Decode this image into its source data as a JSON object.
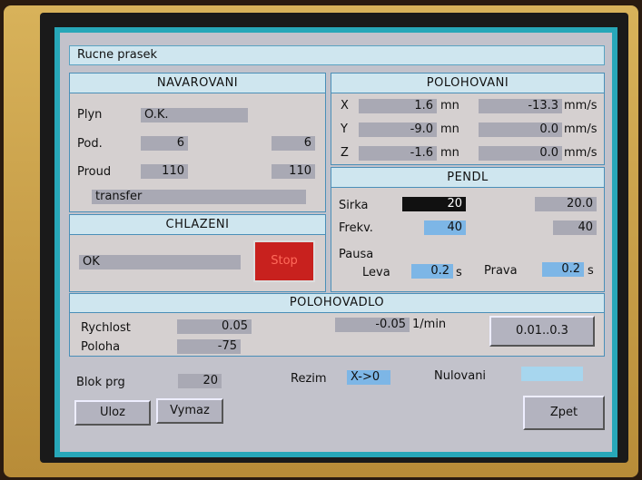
{
  "window_title": "Rucne prasek",
  "navarovani": {
    "title": "NAVAROVANI",
    "plyn_label": "Plyn",
    "plyn_value": "O.K.",
    "pod_label": "Pod.",
    "pod_set": "6",
    "pod_actual": "6",
    "proud_label": "Proud",
    "proud_set": "110",
    "proud_actual": "110",
    "mode_value": "transfer"
  },
  "polohovani": {
    "title": "POLOHOVANI",
    "rows": [
      {
        "axis": "X",
        "position": "1.6",
        "position_unit": "mn",
        "speed": "-13.3",
        "speed_unit": "mm/s"
      },
      {
        "axis": "Y",
        "position": "-9.0",
        "position_unit": "mn",
        "speed": "0.0",
        "speed_unit": "mm/s"
      },
      {
        "axis": "Z",
        "position": "-1.6",
        "position_unit": "mn",
        "speed": "0.0",
        "speed_unit": "mm/s"
      }
    ]
  },
  "pendl": {
    "title": "PENDL",
    "sirka_label": "Sirka",
    "sirka_set": "20",
    "sirka_actual": "20.0",
    "frekv_label": "Frekv.",
    "frekv_set": "40",
    "frekv_actual": "40",
    "pausa_label": "Pausa",
    "leva_label": "Leva",
    "leva_value": "0.2",
    "leva_unit": "s",
    "prava_label": "Prava",
    "prava_value": "0.2",
    "prava_unit": "s"
  },
  "chlazeni": {
    "title": "CHLAZENI",
    "status_value": "OK",
    "stop_label": "Stop"
  },
  "polohovadlo": {
    "title": "POLOHOVADLO",
    "rychlost_label": "Rychlost",
    "rychlost_value": "0.05",
    "rychlost_actual": "-0.05",
    "rychlost_unit": "1/min",
    "poloha_label": "Poloha",
    "poloha_value": "-75",
    "range_button": "0.01..0.3"
  },
  "footer": {
    "blok_label": "Blok prg",
    "blok_value": "20",
    "rezim_label": "Rezim",
    "rezim_value": "X->0",
    "nulovani_label": "Nulovani",
    "nulovani_value": "",
    "uloz_button": "Uloz",
    "vymaz_button": "Vymaz",
    "zpet_button": "Zpet"
  },
  "colors": {
    "frame_cyan": "#27a7b8",
    "stop_red": "#c8211e",
    "input_blue": "#7db6e6",
    "field_gray": "#a9a9b4"
  }
}
